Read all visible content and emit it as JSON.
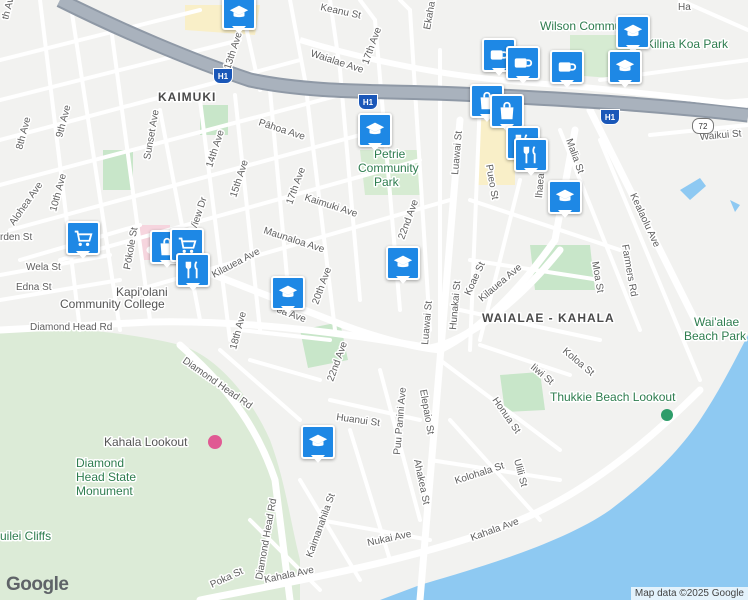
{
  "map": {
    "neighborhoods": {
      "kaimuki": "KAIMUKI",
      "waialae_kahala": "WAIALAE - KAHALA"
    },
    "parks": {
      "wilson": "Wilson Community",
      "kilina_koa": "Kilina Koa Park",
      "petrie_1": "Petrie",
      "petrie_2": "Community",
      "petrie_3": "Park",
      "waialae_beach_1": "Wai'alae",
      "waialae_beach_2": "Beach Park"
    },
    "places": {
      "kapiolani_1": "Kapi'olani",
      "kapiolani_2": "Community College",
      "kahala_lookout": "Kahala Lookout",
      "diamond_head_1": "Diamond",
      "diamond_head_2": "Head State",
      "diamond_head_3": "Monument",
      "thukkie": "Thukkie Beach Lookout",
      "cliffs": "uilei Cliffs"
    },
    "streets": {
      "waialae_ave": "Waialae Ave",
      "kilauea_ave_left": "Kilauea Ave",
      "kilauea_ave_right": "Kilauea Ave",
      "diamond_head_rd": "Diamond Head Rd",
      "diamond_head_rd2": "Diamond Head Rd",
      "diamond_head_rd3": "Diamond Head Rd",
      "kahala_ave": "Kahala Ave",
      "kahala_ave2": "Kahala Ave",
      "pahoa_ave": "Pāhoa Ave",
      "kaimuki_ave": "Kaimuki Ave",
      "maunaloa_ave": "Maunaloa Ave",
      "ave_20th": "20th Ave",
      "ave_22nd": "22nd Ave",
      "ave_22nd_b": "22nd Ave",
      "ave_17th": "17th Ave",
      "ave_17th_b": "17th Ave",
      "ave_18th": "18th Ave",
      "ave_15th": "15th Ave",
      "ave_14th": "14th Ave",
      "ave_13th": "13th Ave",
      "ocean_view": "Ocean View Dr",
      "sunset_ave": "Sunset Ave",
      "ave_10th": "10th Ave",
      "ave_9th": "9th Ave",
      "ave_8th": "8th Ave",
      "alohea_ave": "Alohea Ave",
      "pokole_st": "Pōkole St",
      "wela_st": "Wela St",
      "edna_st": "Edna St",
      "arden_st": "rden St",
      "keanu_st": "Keanu St",
      "ekaha_ave": "Ekaha Ave",
      "luawai_st": "Luawai St",
      "luawai_st_b": "Luawai St",
      "hunakai_st": "Hunakai St",
      "koae_st": "Koae St",
      "pueo_st": "Pueo St",
      "kealaolu_ave": "Kealaolu Ave",
      "waikui_st": "Waikui St",
      "farmers_rd": "Farmers Rd",
      "moa_st": "Moa St",
      "koloa_st": "Koloa St",
      "iiwi_st": "Iiwi St",
      "honua_st": "Honua St",
      "ulili_st": "Ulili St",
      "kolohala_st": "Kolohala St",
      "elepaio_st": "Elepaio St",
      "ahakea_st": "Ahakea St",
      "puu_panini": "Puu Panini Ave",
      "huanui_st": "Huanui St",
      "kaimanahila_st": "Kaimanahila St",
      "nukai_ave": "Nukai Ave",
      "poka_st": "Poka St",
      "malia_st": "Malia St",
      "ave_6th": "th Ave",
      "ea_ave": "ea Ave",
      "uluhia": "lhaea Ave",
      "ha_st": "Ha"
    },
    "shields": {
      "h1_a": "H1",
      "h1_b": "H1",
      "h1_c": "H1",
      "route72": "72"
    }
  },
  "footer": {
    "logo": "Google",
    "attribution": "Map data ©2025 Google"
  },
  "colors": {
    "marker": "#1e88e5",
    "park": "#c8e6c9",
    "water": "#8ec9f2",
    "highway": "#9aa4b1",
    "land_green": "#dcebd7"
  }
}
